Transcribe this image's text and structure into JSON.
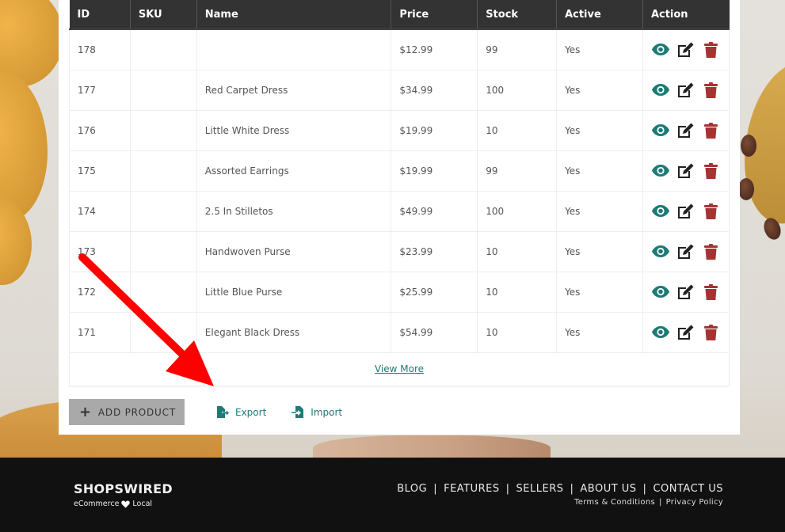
{
  "table": {
    "columns": [
      "ID",
      "SKU",
      "Name",
      "Price",
      "Stock",
      "Active",
      "Action"
    ],
    "rows": [
      {
        "id": "178",
        "sku": "",
        "name": "",
        "price": "$12.99",
        "stock": "99",
        "active": "Yes"
      },
      {
        "id": "177",
        "sku": "",
        "name": "Red Carpet Dress",
        "price": "$34.99",
        "stock": "100",
        "active": "Yes"
      },
      {
        "id": "176",
        "sku": "",
        "name": "Little White Dress",
        "price": "$19.99",
        "stock": "10",
        "active": "Yes"
      },
      {
        "id": "175",
        "sku": "",
        "name": "Assorted Earrings",
        "price": "$19.99",
        "stock": "99",
        "active": "Yes"
      },
      {
        "id": "174",
        "sku": "",
        "name": "2.5 In Stilletos",
        "price": "$49.99",
        "stock": "100",
        "active": "Yes"
      },
      {
        "id": "173",
        "sku": "",
        "name": "Handwoven Purse",
        "price": "$23.99",
        "stock": "10",
        "active": "Yes"
      },
      {
        "id": "172",
        "sku": "",
        "name": "Little Blue Purse",
        "price": "$25.99",
        "stock": "10",
        "active": "Yes"
      },
      {
        "id": "171",
        "sku": "",
        "name": "Elegant Black Dress",
        "price": "$54.99",
        "stock": "10",
        "active": "Yes"
      }
    ],
    "action_icons": [
      "eye-icon",
      "edit-icon",
      "trash-icon"
    ],
    "view_more": "View More"
  },
  "toolbar": {
    "add_product": "ADD PRODUCT",
    "export": "Export",
    "import": "Import"
  },
  "footer": {
    "brand": "SHOPSWIRED",
    "tagline_left": "eCommerce",
    "tagline_right": "Local",
    "nav": [
      "BLOG",
      "FEATURES",
      "SELLERS",
      "ABOUT US",
      "CONTACT US"
    ],
    "legal": [
      "Terms & Conditions",
      "Privacy Policy"
    ],
    "separator": "|"
  },
  "colors": {
    "accent_teal": "#1e7a75",
    "delete_red": "#a83232",
    "header_dark": "#333333",
    "annotation_arrow": "#ff0000"
  }
}
